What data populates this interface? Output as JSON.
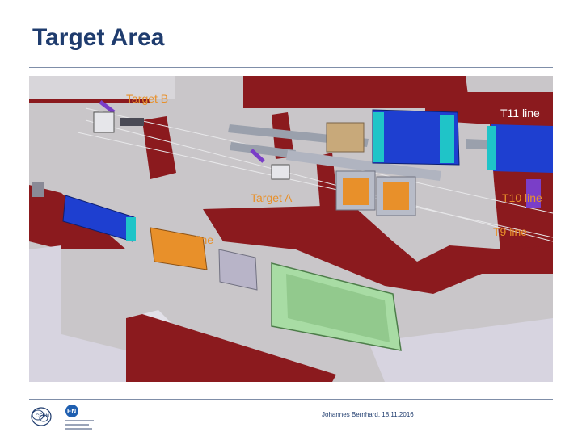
{
  "slide": {
    "title": "Target Area",
    "footer": "Johannes Bernhard, 18.11.2016"
  },
  "labels": {
    "target_b": "Target B",
    "target_a": "Target A",
    "t11": "T11 line",
    "t10": "T10 line",
    "t9": "T9 line",
    "t8": "T8 line"
  },
  "colors": {
    "title": "#1f3c6e",
    "label_orange": "#e8902a",
    "label_white": "#ffffff",
    "wall_red": "#8b1a1e",
    "magnet_blue": "#1e3fd0",
    "magnet_green": "#a8dca4",
    "floor_gray": "#c9c6c9"
  },
  "logos": {
    "cern_icon": "cern-logo-icon",
    "en_icon": "en-department-logo-icon"
  }
}
